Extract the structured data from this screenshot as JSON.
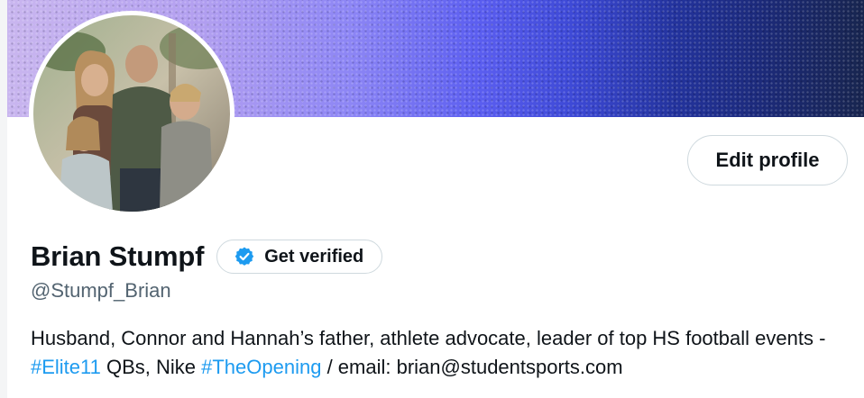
{
  "profile": {
    "name": "Brian Stumpf",
    "handle": "@Stumpf_Brian",
    "get_verified_label": "Get verified",
    "edit_profile_label": "Edit profile",
    "bio": {
      "part1": "Husband, Connor and Hannah’s father, athlete advocate, leader of top HS football events - ",
      "hashtag1": "#Elite11",
      "part2": " QBs, Nike ",
      "hashtag2": "#TheOpening",
      "part3": " / email: brian@studentsports.com"
    }
  },
  "colors": {
    "accent": "#1d9bf0",
    "text": "#0f1419",
    "secondary_text": "#536471",
    "border": "#cfd9de"
  },
  "icons": {
    "verified": "verified-badge-icon"
  }
}
